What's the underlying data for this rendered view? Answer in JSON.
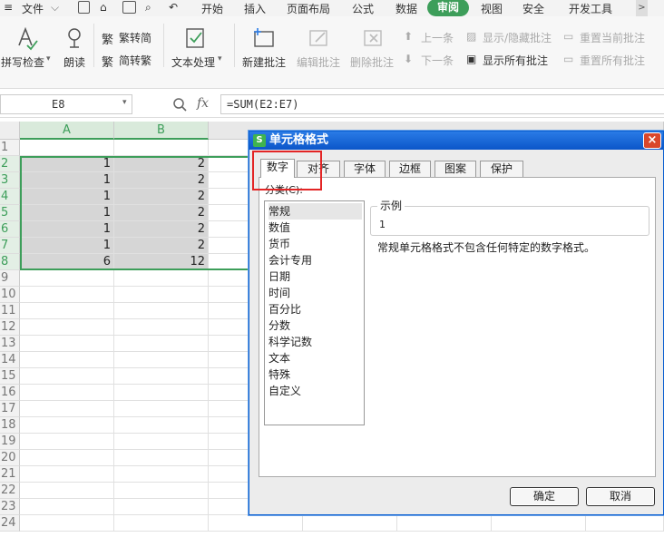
{
  "menu": {
    "file": "文件",
    "tabs": [
      "开始",
      "插入",
      "页面布局",
      "公式",
      "数据",
      "审阅",
      "视图",
      "安全",
      "开发工具"
    ],
    "active_tab": "审阅",
    "overflow": ">"
  },
  "ribbon": {
    "spellcheck": "拼写检查",
    "read_aloud": "朗读",
    "trad_to_simp": "繁转简",
    "simp_to_trad": "简转繁",
    "text_process": "文本处理",
    "new_comment": "新建批注",
    "edit_comment": "编辑批注",
    "delete_comment": "删除批注",
    "prev": "上一条",
    "next": "下一条",
    "show_hide_comment": "显示/隐藏批注",
    "show_all_comments": "显示所有批注",
    "reset_current": "重置当前批注",
    "reset_all": "重置所有批注"
  },
  "formula_bar": {
    "name_box": "E8",
    "fx": "fx",
    "formula": "=SUM(E2:E7)"
  },
  "sheet": {
    "columns": [
      "A",
      "B"
    ],
    "rows": [
      "1",
      "2",
      "3",
      "4",
      "5",
      "6",
      "7",
      "8",
      "9",
      "10",
      "11",
      "12",
      "13",
      "14",
      "15",
      "16",
      "17",
      "18",
      "19",
      "20",
      "21",
      "22",
      "23",
      "24"
    ],
    "data": [
      [
        "1",
        "2"
      ],
      [
        "1",
        "2"
      ],
      [
        "1",
        "2"
      ],
      [
        "1",
        "2"
      ],
      [
        "1",
        "2"
      ],
      [
        "1",
        "2"
      ],
      [
        "6",
        "12"
      ]
    ]
  },
  "dialog": {
    "title": "单元格格式",
    "logo": "S",
    "close": "×",
    "tabs": [
      "数字",
      "对齐",
      "字体",
      "边框",
      "图案",
      "保护"
    ],
    "category_label": "分类(C):",
    "categories": [
      "常规",
      "数值",
      "货币",
      "会计专用",
      "日期",
      "时间",
      "百分比",
      "分数",
      "科学记数",
      "文本",
      "特殊",
      "自定义"
    ],
    "selected_category": "常规",
    "sample_label": "示例",
    "sample_value": "1",
    "description": "常规单元格格式不包含任何特定的数字格式。",
    "ok": "确定",
    "cancel": "取消"
  },
  "colors": {
    "accent": "#3d9e5a",
    "highlight": "#e32525",
    "title_bar": "#0b56c9"
  }
}
